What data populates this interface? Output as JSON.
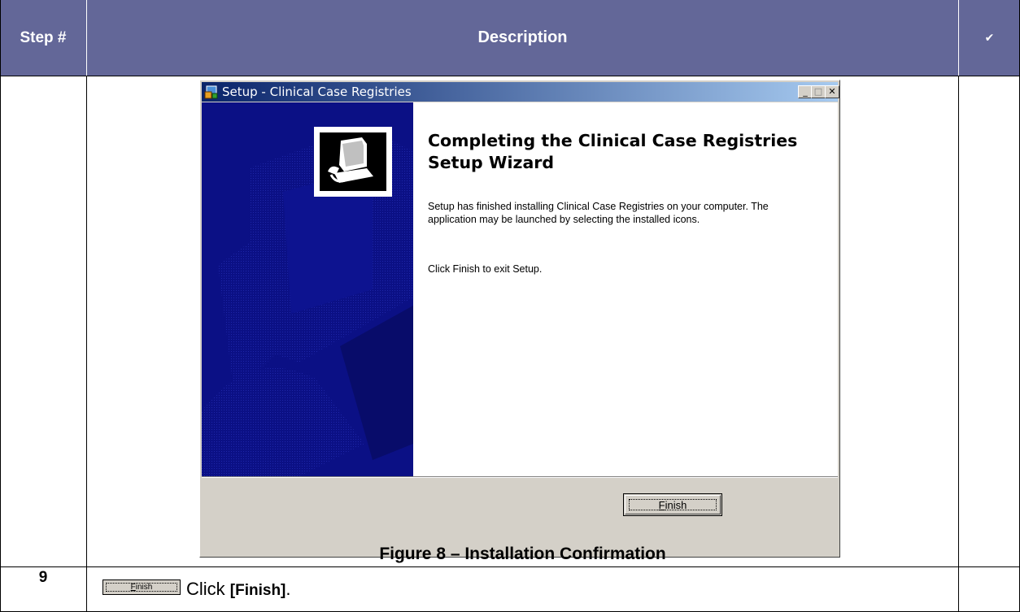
{
  "table": {
    "header": {
      "step": "Step #",
      "description": "Description",
      "check": "✔"
    },
    "rows": [
      {
        "step": "",
        "figure_caption": "Figure 8 – Installation Confirmation"
      },
      {
        "step": "9",
        "instruction_prefix": "Click ",
        "instruction_bold": "[Finish]",
        "instruction_suffix": "."
      }
    ]
  },
  "dialog": {
    "title": "Setup - Clinical Case Registries",
    "heading": "Completing the Clinical Case Registries Setup Wizard",
    "paragraph1": "Setup has finished installing Clinical Case Registries on your computer. The application may be launched by selecting the installed icons.",
    "paragraph2": "Click Finish to exit Setup.",
    "finish_button": {
      "accel": "F",
      "rest": "inish"
    },
    "title_buttons": {
      "minimize": "_",
      "maximize": "□",
      "close": "✕"
    }
  },
  "inline_button": {
    "accel": "F",
    "rest": "inish"
  },
  "colors": {
    "header_bg": "#636798",
    "wizard_panel": "#0b1085",
    "window_face": "#d4d0c8"
  },
  "icons": {
    "app_icon": "setup-icon",
    "wizard_image": "computer-install-icon"
  }
}
